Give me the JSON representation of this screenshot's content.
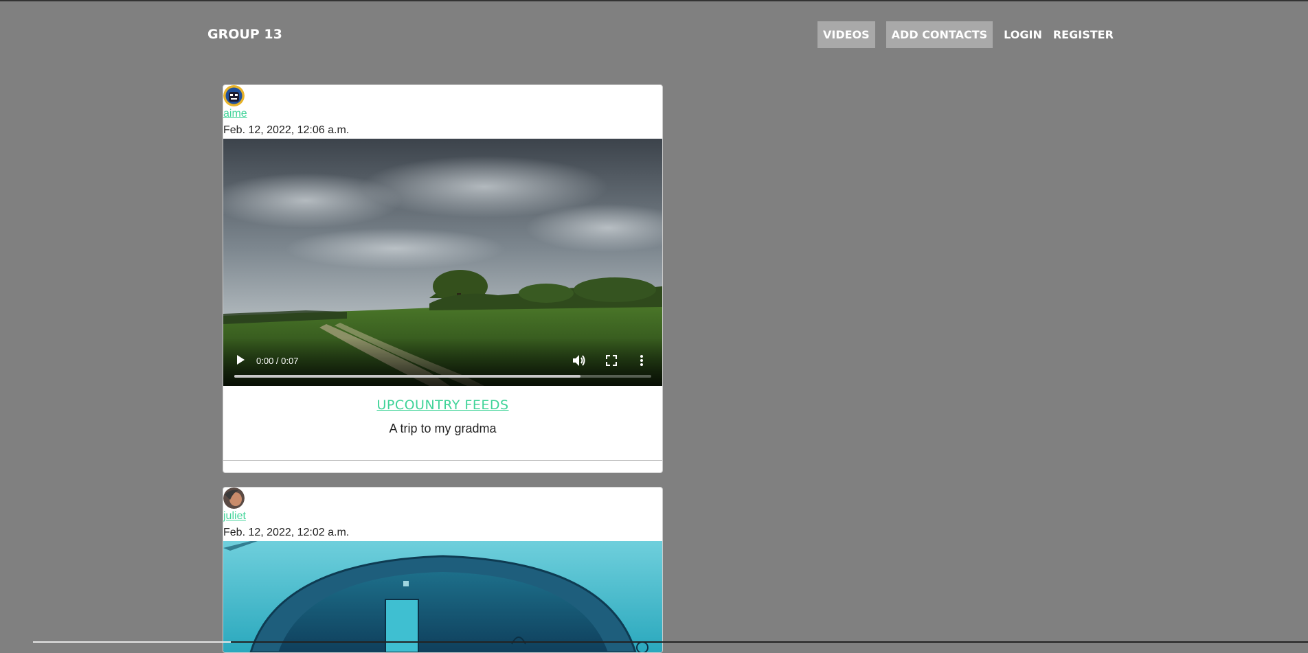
{
  "app": {
    "brand": "GROUP 13"
  },
  "nav": {
    "videos": "VIDEOS",
    "add_contacts": "ADD CONTACTS",
    "login": "LOGIN",
    "register": "REGISTER"
  },
  "posts": [
    {
      "username": "aime",
      "timestamp": "Feb. 12, 2022, 12:06 a.m.",
      "video_time": "0:00 / 0:07",
      "progress_buffered": 0.83,
      "title": "UPCOUNTRY FEEDS",
      "description": "A trip to my gradma",
      "video_scene": "cloudy-sky-meadow-tree"
    },
    {
      "username": "juliet",
      "timestamp": "Feb. 12, 2022, 12:02 a.m.",
      "video_scene": "underwater-tunnel"
    }
  ],
  "icons": {
    "play": "play-icon",
    "volume": "volume-icon",
    "fullscreen": "fullscreen-icon",
    "more": "more-vertical-icon"
  },
  "colors": {
    "background": "#808080",
    "accent": "#3fd398",
    "nav_active": "#a9a9a9"
  }
}
